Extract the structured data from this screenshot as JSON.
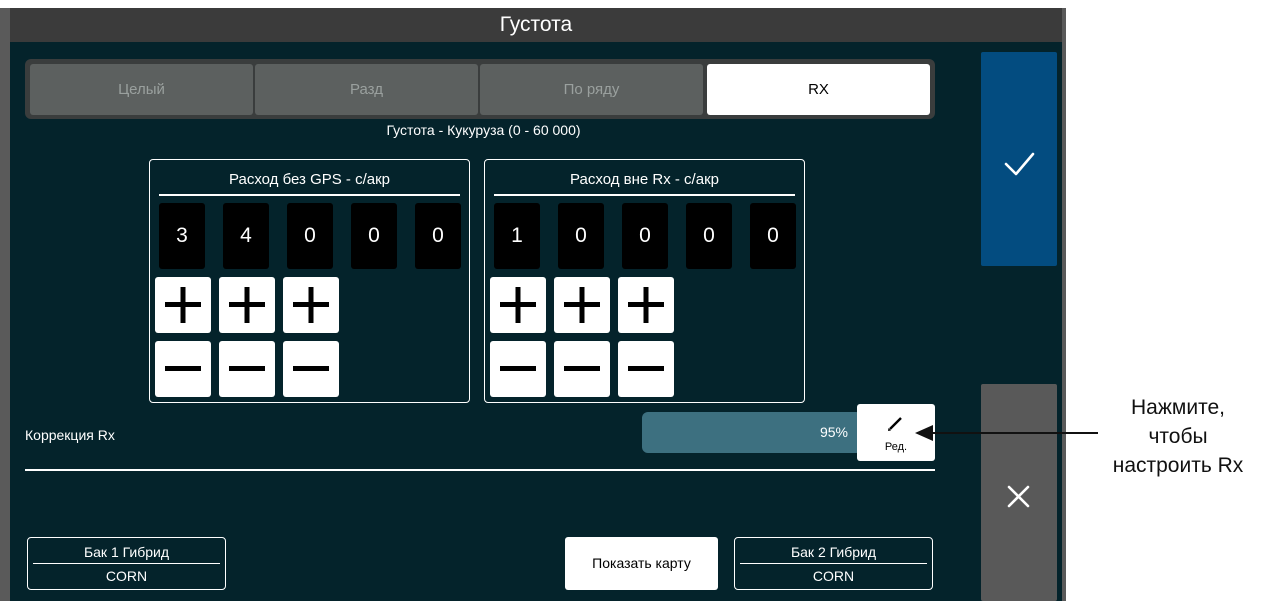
{
  "window": {
    "title": "Густота"
  },
  "tabs": [
    {
      "label": "Целый",
      "active": false
    },
    {
      "label": "Разд",
      "active": false
    },
    {
      "label": "По ряду",
      "active": false
    },
    {
      "label": "RX",
      "active": true
    }
  ],
  "subtitle": "Густота - Кукуруза (0 - 60 000)",
  "panels": [
    {
      "title": "Расход без GPS - с/акр",
      "digits": [
        "3",
        "4",
        "0",
        "0",
        "0"
      ]
    },
    {
      "title": "Расход вне Rx - с/акр",
      "digits": [
        "1",
        "0",
        "0",
        "0",
        "0"
      ]
    }
  ],
  "icons": {
    "plus": "plus-icon",
    "minus": "minus-icon",
    "confirm": "checkmark-icon",
    "cancel": "close-icon",
    "edit": "pencil-icon"
  },
  "correction": {
    "label": "Коррекция Rx",
    "value": "95%",
    "edit_label": "Ред."
  },
  "hybrids": [
    {
      "title": "Бак 1 Гибрид",
      "value": "CORN"
    },
    {
      "title": "Бак 2 Гибрид",
      "value": "CORN"
    }
  ],
  "show_map_label": "Показать карту",
  "callout": {
    "line1": "Нажмите,",
    "line2": "чтобы",
    "line3": "настроить Rx"
  },
  "colors": {
    "background": "#04232b",
    "confirm": "#034c80",
    "cancel": "#595959",
    "correction_bar": "#3d7080"
  }
}
